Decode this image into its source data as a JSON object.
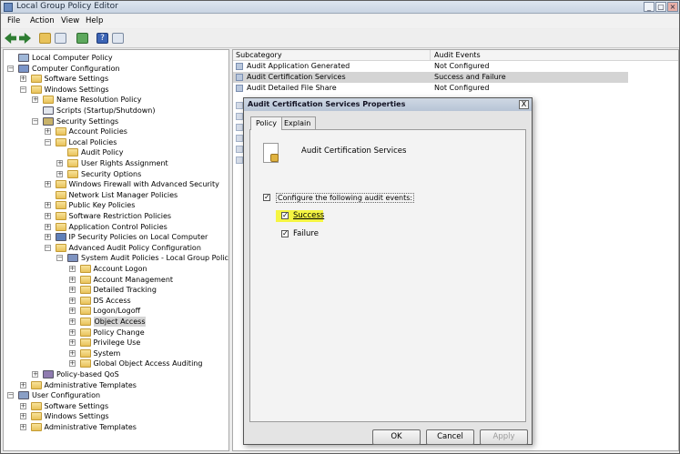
{
  "window": {
    "title": "Local Group Policy Editor"
  },
  "menu": [
    "File",
    "Action",
    "View",
    "Help"
  ],
  "tree": [
    {
      "label": "Local Computer Policy",
      "depth": 0,
      "exp": "",
      "icon": "computer-policy"
    },
    {
      "label": "Computer Configuration",
      "depth": 0,
      "exp": "-",
      "icon": "computer"
    },
    {
      "label": "Software Settings",
      "depth": 1,
      "exp": "+",
      "icon": "folder"
    },
    {
      "label": "Windows Settings",
      "depth": 1,
      "exp": "-",
      "icon": "folder"
    },
    {
      "label": "Name Resolution Policy",
      "depth": 2,
      "exp": "+",
      "icon": "folder"
    },
    {
      "label": "Scripts (Startup/Shutdown)",
      "depth": 2,
      "exp": "",
      "icon": "script"
    },
    {
      "label": "Security Settings",
      "depth": 2,
      "exp": "-",
      "icon": "security"
    },
    {
      "label": "Account Policies",
      "depth": 3,
      "exp": "+",
      "icon": "folder"
    },
    {
      "label": "Local Policies",
      "depth": 3,
      "exp": "-",
      "icon": "folder"
    },
    {
      "label": "Audit Policy",
      "depth": 4,
      "exp": "",
      "icon": "folder"
    },
    {
      "label": "User Rights Assignment",
      "depth": 4,
      "exp": "+",
      "icon": "folder"
    },
    {
      "label": "Security Options",
      "depth": 4,
      "exp": "+",
      "icon": "folder"
    },
    {
      "label": "Windows Firewall with Advanced Security",
      "depth": 3,
      "exp": "+",
      "icon": "folder"
    },
    {
      "label": "Network List Manager Policies",
      "depth": 3,
      "exp": "",
      "icon": "folder"
    },
    {
      "label": "Public Key Policies",
      "depth": 3,
      "exp": "+",
      "icon": "folder"
    },
    {
      "label": "Software Restriction Policies",
      "depth": 3,
      "exp": "+",
      "icon": "folder"
    },
    {
      "label": "Application Control Policies",
      "depth": 3,
      "exp": "+",
      "icon": "folder"
    },
    {
      "label": "IP Security Policies on Local Computer",
      "depth": 3,
      "exp": "+",
      "icon": "ipsec"
    },
    {
      "label": "Advanced Audit Policy Configuration",
      "depth": 3,
      "exp": "-",
      "icon": "folder"
    },
    {
      "label": "System Audit Policies - Local Group Policy Obje",
      "depth": 4,
      "exp": "-",
      "icon": "audit"
    },
    {
      "label": "Account Logon",
      "depth": 5,
      "exp": "+",
      "icon": "folder"
    },
    {
      "label": "Account Management",
      "depth": 5,
      "exp": "+",
      "icon": "folder"
    },
    {
      "label": "Detailed Tracking",
      "depth": 5,
      "exp": "+",
      "icon": "folder"
    },
    {
      "label": "DS Access",
      "depth": 5,
      "exp": "+",
      "icon": "folder"
    },
    {
      "label": "Logon/Logoff",
      "depth": 5,
      "exp": "+",
      "icon": "folder"
    },
    {
      "label": "Object Access",
      "depth": 5,
      "exp": "+",
      "icon": "folder",
      "selected": true
    },
    {
      "label": "Policy Change",
      "depth": 5,
      "exp": "+",
      "icon": "folder"
    },
    {
      "label": "Privilege Use",
      "depth": 5,
      "exp": "+",
      "icon": "folder"
    },
    {
      "label": "System",
      "depth": 5,
      "exp": "+",
      "icon": "folder"
    },
    {
      "label": "Global Object Access Auditing",
      "depth": 5,
      "exp": "+",
      "icon": "folder"
    },
    {
      "label": "Policy-based QoS",
      "depth": 2,
      "exp": "+",
      "icon": "qos"
    },
    {
      "label": "Administrative Templates",
      "depth": 1,
      "exp": "+",
      "icon": "folder"
    },
    {
      "label": "User Configuration",
      "depth": 0,
      "exp": "-",
      "icon": "user"
    },
    {
      "label": "Software Settings",
      "depth": 1,
      "exp": "+",
      "icon": "folder"
    },
    {
      "label": "Windows Settings",
      "depth": 1,
      "exp": "+",
      "icon": "folder"
    },
    {
      "label": "Administrative Templates",
      "depth": 1,
      "exp": "+",
      "icon": "folder"
    }
  ],
  "list": {
    "columns": [
      "Subcategory",
      "Audit Events"
    ],
    "rows": [
      {
        "name": "Audit Application Generated",
        "value": "Not Configured"
      },
      {
        "name": "Audit Certification Services",
        "value": "Success and Failure",
        "selected": true
      },
      {
        "name": "Audit Detailed File Share",
        "value": "Not Configured"
      }
    ]
  },
  "dialog": {
    "title": "Audit Certification Services Properties",
    "tabs": [
      "Policy",
      "Explain"
    ],
    "heading": "Audit Certification Services",
    "configure_label": "Configure the following audit events:",
    "success_label": "Success",
    "failure_label": "Failure",
    "ok": "OK",
    "cancel": "Cancel",
    "apply": "Apply",
    "close_glyph": "X"
  },
  "colors": {
    "highlight": "#f5f542",
    "selection": "#d4d4d4"
  }
}
